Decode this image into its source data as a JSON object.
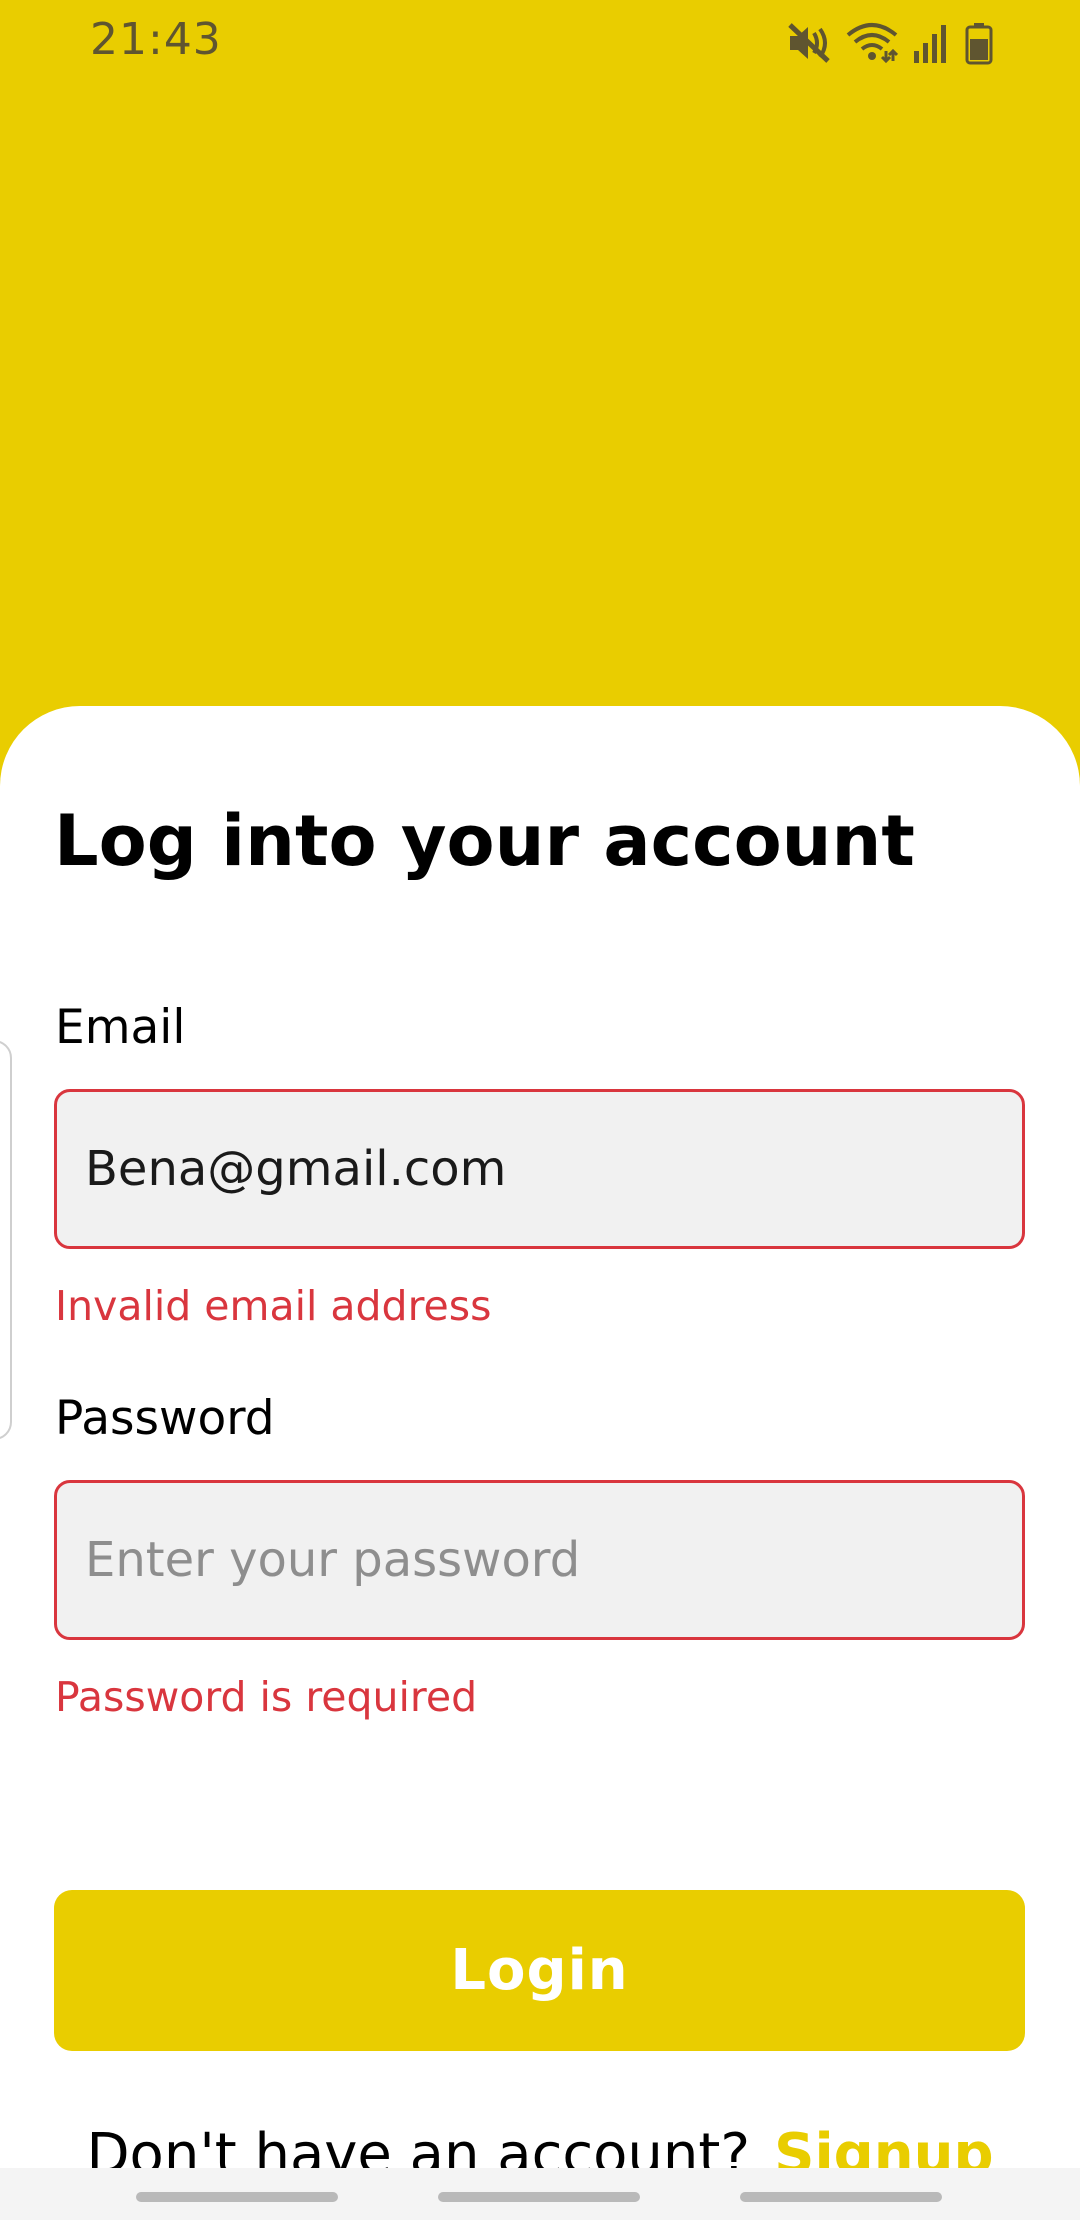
{
  "status_bar": {
    "time": "21:43",
    "icons": [
      "mute-icon",
      "wifi-icon",
      "signal-icon",
      "battery-icon"
    ]
  },
  "colors": {
    "accent": "#E9CD00",
    "error": "#D9363E"
  },
  "form": {
    "title": "Log into your account",
    "email": {
      "label": "Email",
      "value": "Bena@gmail.com",
      "error": "Invalid email address"
    },
    "password": {
      "label": "Password",
      "placeholder": "Enter your password",
      "error": "Password is required"
    },
    "login_label": "Login",
    "signup_prompt": "Don't have an account?",
    "signup_label": "Signup"
  }
}
